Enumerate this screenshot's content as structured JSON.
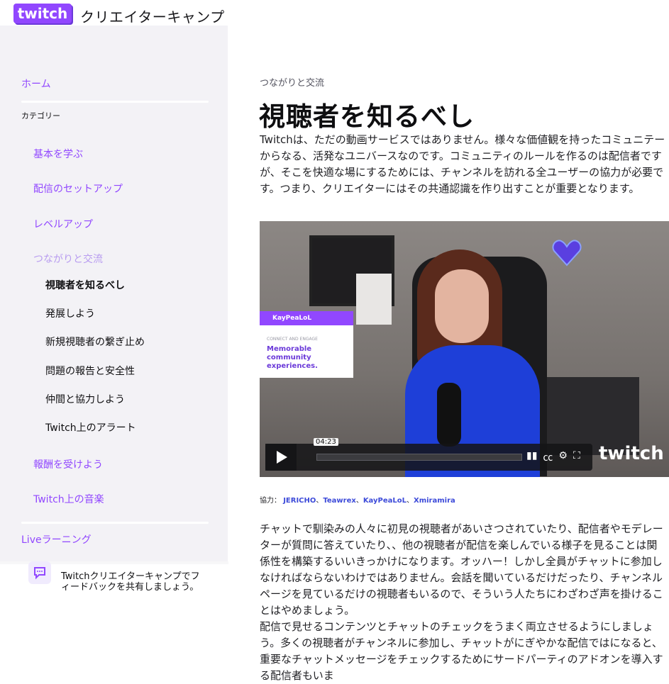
{
  "header": {
    "title": "クリエイターキャンプ",
    "logo_text": "twitch",
    "brand_color": "#9147ff"
  },
  "sidebar": {
    "home": "ホーム",
    "category_label": "カテゴリー",
    "categories": [
      "基本を学ぶ",
      "配信のセットアップ",
      "レベルアップ",
      "つながりと交流"
    ],
    "subitems": [
      "視聴者を知るべし",
      "発展しよう",
      "新規視聴者の繋ぎ止め",
      "問題の報告と安全性",
      "仲間と協力しよう",
      "Twitch上のアラート"
    ],
    "more_categories": [
      "報酬を受けよう",
      "Twitch上の音楽"
    ],
    "live_learning": "Liveラーニング",
    "feedback": "Twitchクリエイターキャンプでフィードバックを共有しましょう。"
  },
  "main": {
    "breadcrumb": "つながりと交流",
    "title": "視聴者を知るべし",
    "intro": "Twitchは、ただの動画サービスではありません。様々な価値観を持ったコミュニテーからなる、活発なユニバースなのです。コミュニティのルールを作るのは配信者ですが、そこを快適な場にするためには、チャンネルを訪れる全ユーザーの協力が必要です。つまり、クリエイターにはその共通認識を作り出すことが重要となります。",
    "video": {
      "card_channel": "KayPeaLoL",
      "card_sub": "CONNECT AND ENGAGE",
      "card_main": "Memorable community experiences.",
      "watermark": "twitch",
      "time": "04:23"
    },
    "credits": {
      "label": "協力：",
      "names": [
        "JERICHO",
        "Teawrex",
        "KayPeaLoL",
        "Xmiramira"
      ],
      "separator": "、"
    },
    "para2": "チャットで馴染みの人々に初見の視聴者があいさつされていたり、配信者やモデレーターが質問に答えていたり、、他の視聴者が配信を楽しんでいる様子を見ることは関係性を構築するいいきっかけになります。オッハー！しかし全員がチャットに参加しなければならないわけではありません。会話を聞いているだけだったり、チャンネルページを見ているだけの視聴者もいるので、そういう人たちにわざわざ声を掛けることはやめましょう。",
    "para3": "配信で見せるコンテンツとチャットのチェックをうまく両立させるようにしましょう。多くの視聴者がチャンネルに参加し、チャットがにぎやかな配信ではになると、重要なチャットメッセージをチェックするためにサードパーティのアドオンを導入する配信者もいま"
  }
}
